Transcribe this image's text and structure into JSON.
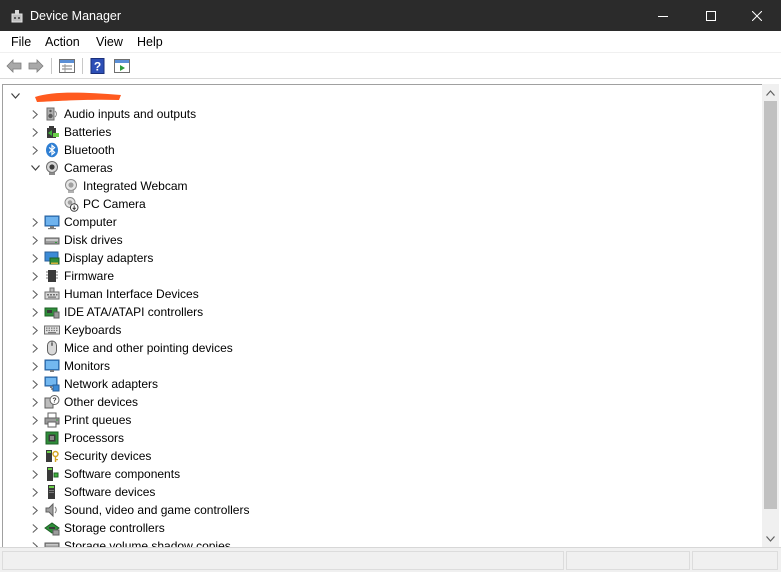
{
  "window": {
    "title": "Device Manager",
    "controls": {
      "minimize": "minimize-icon",
      "maximize": "maximize-icon",
      "close": "close-icon"
    }
  },
  "menu": [
    "File",
    "Action",
    "View",
    "Help"
  ],
  "toolbar": {
    "buttons": [
      "back-arrow-icon",
      "forward-arrow-icon",
      "properties-icon",
      "help-icon",
      "update-driver-icon"
    ]
  },
  "tree": {
    "root": {
      "label": "",
      "expanded": true,
      "redacted": true
    },
    "categories": [
      {
        "label": "Audio inputs and outputs",
        "icon": "speaker-icon",
        "expanded": false
      },
      {
        "label": "Batteries",
        "icon": "battery-icon",
        "expanded": false
      },
      {
        "label": "Bluetooth",
        "icon": "bluetooth-icon",
        "expanded": false
      },
      {
        "label": "Cameras",
        "icon": "camera-icon",
        "expanded": true,
        "children": [
          {
            "label": "Integrated Webcam",
            "icon": "webcam-icon"
          },
          {
            "label": "PC Camera",
            "icon": "webcam-disabled-icon"
          }
        ]
      },
      {
        "label": "Computer",
        "icon": "computer-icon",
        "expanded": false
      },
      {
        "label": "Disk drives",
        "icon": "disk-drive-icon",
        "expanded": false
      },
      {
        "label": "Display adapters",
        "icon": "display-adapter-icon",
        "expanded": false
      },
      {
        "label": "Firmware",
        "icon": "firmware-icon",
        "expanded": false
      },
      {
        "label": "Human Interface Devices",
        "icon": "hid-icon",
        "expanded": false
      },
      {
        "label": "IDE ATA/ATAPI controllers",
        "icon": "ide-controller-icon",
        "expanded": false
      },
      {
        "label": "Keyboards",
        "icon": "keyboard-icon",
        "expanded": false
      },
      {
        "label": "Mice and other pointing devices",
        "icon": "mouse-icon",
        "expanded": false
      },
      {
        "label": "Monitors",
        "icon": "monitor-icon",
        "expanded": false
      },
      {
        "label": "Network adapters",
        "icon": "network-adapter-icon",
        "expanded": false
      },
      {
        "label": "Other devices",
        "icon": "other-devices-icon",
        "expanded": false
      },
      {
        "label": "Print queues",
        "icon": "printer-icon",
        "expanded": false
      },
      {
        "label": "Processors",
        "icon": "processor-icon",
        "expanded": false
      },
      {
        "label": "Security devices",
        "icon": "security-device-icon",
        "expanded": false
      },
      {
        "label": "Software components",
        "icon": "software-component-icon",
        "expanded": false
      },
      {
        "label": "Software devices",
        "icon": "software-device-icon",
        "expanded": false
      },
      {
        "label": "Sound, video and game controllers",
        "icon": "sound-controller-icon",
        "expanded": false
      },
      {
        "label": "Storage controllers",
        "icon": "storage-controller-icon",
        "expanded": false
      },
      {
        "label": "Storage volume shadow copies",
        "icon": "shadow-copy-icon",
        "expanded": false
      }
    ]
  },
  "scrollbar": {
    "position": 0,
    "visible_fraction": 0.95
  },
  "colors": {
    "titlebar_bg": "#2b2b2b",
    "redaction": "#ff5a1f",
    "window_bg": "#ffffff",
    "status_bg": "#f0f0f0"
  }
}
